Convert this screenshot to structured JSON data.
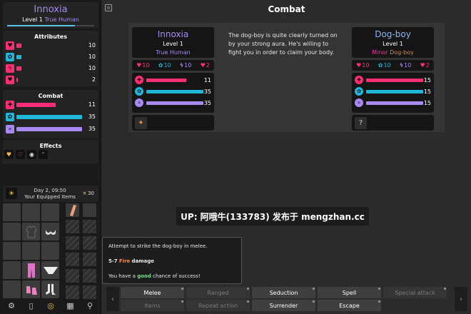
{
  "player": {
    "name": "Innoxia",
    "level_label": "Level 1",
    "race": "True Human",
    "attributes_title": "Attributes",
    "attributes": [
      {
        "icon": "heart-icon",
        "value": "10",
        "color": "#ff2d78",
        "fill": 0.08
      },
      {
        "icon": "brain-icon",
        "value": "10",
        "color": "#1fb6d8",
        "fill": 0.08
      },
      {
        "icon": "lightning-icon",
        "value": "10",
        "color": "#ff2d78",
        "fill": 0.08
      },
      {
        "icon": "lust-icon",
        "value": "2",
        "color": "#ff2d78",
        "fill": 0.02
      }
    ],
    "combat_title": "Combat",
    "combat": [
      {
        "icon": "health-icon",
        "value": "11",
        "color": "#ff2d78",
        "fill": 0.6
      },
      {
        "icon": "aura-icon",
        "value": "35",
        "color": "#1fb6d8",
        "fill": 1.0
      },
      {
        "icon": "arousal-icon",
        "value": "35",
        "color": "#a98af2",
        "fill": 1.0
      }
    ],
    "effects_title": "Effects"
  },
  "inventory": {
    "time": "Day 2, 09:50",
    "label": "Your Equipped Items",
    "money": "30"
  },
  "main": {
    "title": "Combat",
    "description": "The dog-boy is quite clearly turned on by your strong aura. He's willing to fight you in order to claim your body.",
    "left_card": {
      "name": "Innoxia",
      "level": "Level 1",
      "race_prefix": "",
      "race": "True Human",
      "stats": [
        "10",
        "10",
        "10",
        "2"
      ],
      "bars": [
        {
          "value": "11",
          "color": "#ff2d78",
          "fill": 0.7
        },
        {
          "value": "35",
          "color": "#1fb6d8",
          "fill": 1.0
        },
        {
          "value": "35",
          "color": "#a98af2",
          "fill": 1.0
        }
      ]
    },
    "right_card": {
      "name": "Dog-boy",
      "level": "Level 1",
      "race_prefix": "Minor",
      "race": "Dog-boy",
      "stats": [
        "10",
        "10",
        "10",
        "2"
      ],
      "bars": [
        {
          "value": "15",
          "color": "#ff2d78",
          "fill": 1.0
        },
        {
          "value": "15",
          "color": "#1fb6d8",
          "fill": 1.0
        },
        {
          "value": "15",
          "color": "#a98af2",
          "fill": 1.0
        }
      ]
    },
    "watermark": "UP: 阿哦牛(133783) 发布于 mengzhan.cc",
    "log": {
      "line1": "Attempt to strike the dog-boy in melee.",
      "dmg_range": "5-7",
      "dmg_type": "Fire",
      "dmg_suffix": "damage",
      "chance_pre": "You have a",
      "chance_word": "good",
      "chance_post": "chance of success!"
    },
    "actions": [
      {
        "label": "Melee",
        "enabled": true
      },
      {
        "label": "Ranged",
        "enabled": false
      },
      {
        "label": "Seduction",
        "enabled": true
      },
      {
        "label": "Spell",
        "enabled": true
      },
      {
        "label": "Special attack",
        "enabled": false
      },
      {
        "label": "Items",
        "enabled": false
      },
      {
        "label": "Repeat action",
        "enabled": false
      },
      {
        "label": "Surrender",
        "enabled": true
      },
      {
        "label": "Escape",
        "enabled": true
      }
    ]
  }
}
